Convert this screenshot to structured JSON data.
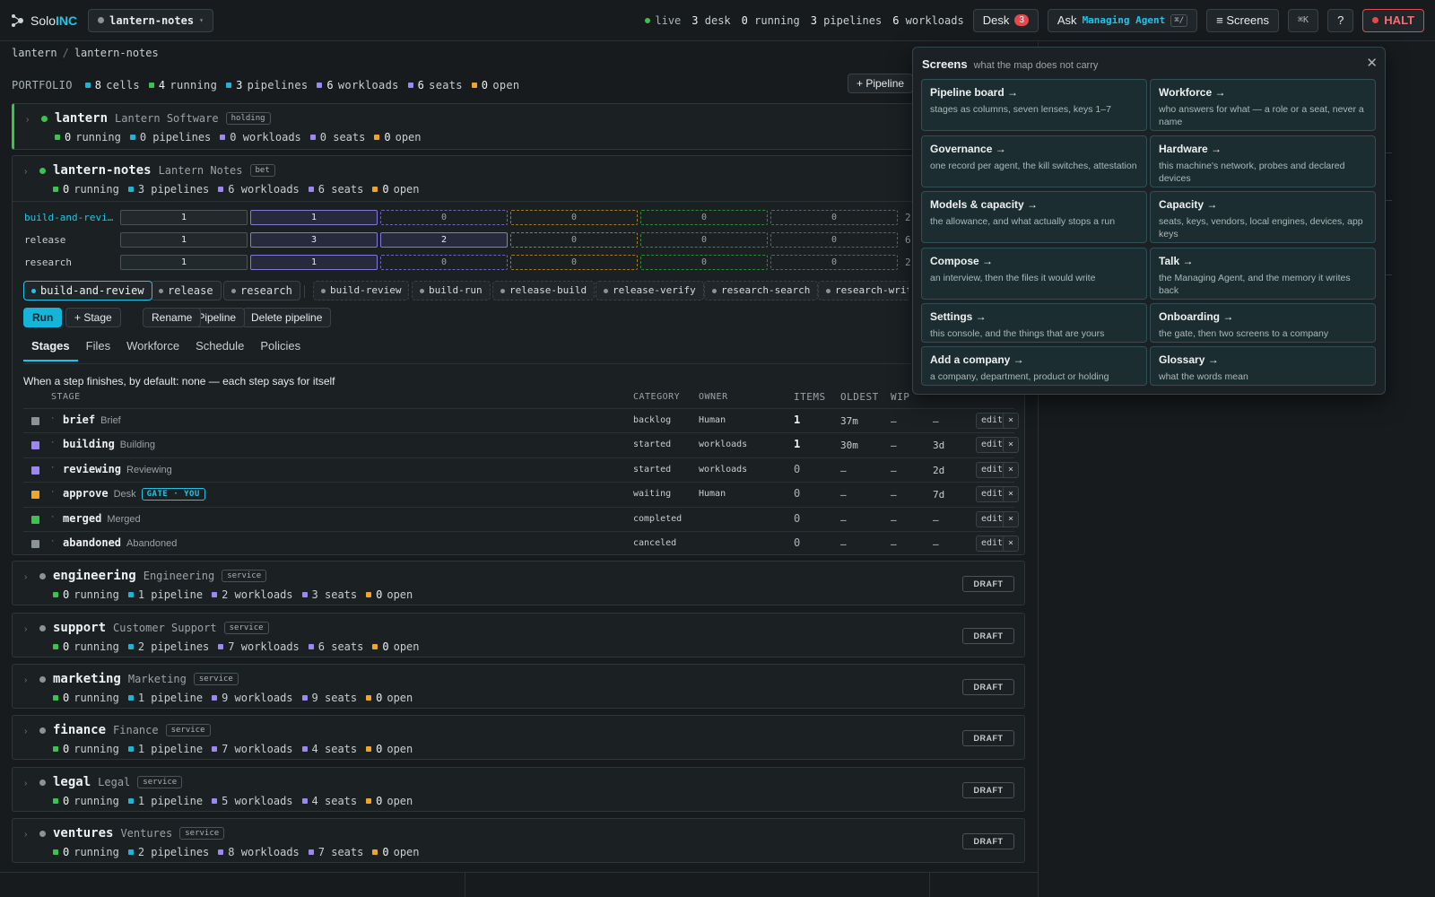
{
  "topbar": {
    "brand_solo": "Solo",
    "brand_inc": "INC",
    "project": "lantern-notes",
    "stats": [
      {
        "value": "live",
        "label": ""
      },
      {
        "value": "3",
        "label": "desk"
      },
      {
        "value": "0",
        "label": "running"
      },
      {
        "value": "3",
        "label": "pipelines"
      },
      {
        "value": "6",
        "label": "workloads"
      }
    ],
    "desk_label": "Desk",
    "desk_count": "3",
    "ask_label": "Ask",
    "ask_agent": "Managing Agent",
    "ask_kbd": "⌘/",
    "screens_label": "≡ Screens",
    "cmdk": "⌘K",
    "help": "?",
    "halt": "HALT"
  },
  "breadcrumb": {
    "root": "lantern",
    "sep": "/",
    "leaf": "lantern-notes"
  },
  "portfolio": {
    "label": "PORTFOLIO",
    "items": [
      {
        "n": "8",
        "l": "cells"
      },
      {
        "n": "4",
        "l": "running"
      },
      {
        "n": "3",
        "l": "pipelines"
      },
      {
        "n": "6",
        "l": "workloads"
      },
      {
        "n": "6",
        "l": "seats"
      },
      {
        "n": "0",
        "l": "open"
      }
    ],
    "add_pipeline": "+ Pipeline"
  },
  "cells": [
    {
      "name": "lantern",
      "full": "Lantern Software",
      "tag": "holding",
      "running": "0",
      "pipelines": "0 pipelines",
      "workloads": "0 workloads",
      "seats": "0 seats",
      "open": "0"
    },
    {
      "name": "lantern-notes",
      "full": "Lantern Notes",
      "tag": "bet",
      "running": "0",
      "pipelines": "3 pipelines",
      "workloads": "6 workloads",
      "seats": "6 seats",
      "open": "0"
    },
    {
      "name": "engineering",
      "full": "Engineering",
      "tag": "service",
      "running": "0",
      "pipelines": "1 pipeline",
      "workloads": "2 workloads",
      "seats": "3 seats",
      "open": "0"
    },
    {
      "name": "support",
      "full": "Customer Support",
      "tag": "service",
      "running": "0",
      "pipelines": "2 pipelines",
      "workloads": "7 workloads",
      "seats": "6 seats",
      "open": "0"
    },
    {
      "name": "marketing",
      "full": "Marketing",
      "tag": "service",
      "running": "0",
      "pipelines": "1 pipeline",
      "workloads": "9 workloads",
      "seats": "9 seats",
      "open": "0"
    },
    {
      "name": "finance",
      "full": "Finance",
      "tag": "service",
      "running": "0",
      "pipelines": "1 pipeline",
      "workloads": "7 workloads",
      "seats": "4 seats",
      "open": "0"
    },
    {
      "name": "legal",
      "full": "Legal",
      "tag": "service",
      "running": "0",
      "pipelines": "1 pipeline",
      "workloads": "5 workloads",
      "seats": "4 seats",
      "open": "0"
    },
    {
      "name": "ventures",
      "full": "Ventures",
      "tag": "service",
      "running": "0",
      "pipelines": "2 pipelines",
      "workloads": "8 workloads",
      "seats": "7 seats",
      "open": "0"
    }
  ],
  "running_suffix": "running",
  "open_suffix": "open",
  "draft": "DRAFT",
  "pipeline_grid": [
    {
      "name": "build-and-revi…",
      "vals": [
        "1",
        "1",
        "0",
        "0",
        "0",
        "0"
      ],
      "tail": "2"
    },
    {
      "name": "release",
      "vals": [
        "1",
        "3",
        "2",
        "0",
        "0",
        "0"
      ],
      "tail": "6"
    },
    {
      "name": "research",
      "vals": [
        "1",
        "1",
        "0",
        "0",
        "0",
        "0"
      ],
      "tail": "2"
    }
  ],
  "pipeline_chips": [
    "build-and-review",
    "release",
    "research"
  ],
  "workload_chips": [
    "build-review",
    "build-run",
    "release-build",
    "release-verify",
    "research-search",
    "research-write"
  ],
  "actions": [
    "Run",
    "+ Stage",
    "Rename",
    "+ Pipeline",
    "Delete pipeline"
  ],
  "tabs": [
    "Stages",
    "Files",
    "Workforce",
    "Schedule",
    "Policies"
  ],
  "default_text": "When a step finishes, by default:  none — each step says for itself",
  "stage_headers": {
    "stage": "STAGE",
    "category": "CATEGORY",
    "owner": "OWNER",
    "items": "ITEMS",
    "oldest": "OLDEST",
    "wip": "WIP"
  },
  "stages": [
    {
      "name": "brief",
      "desc": "Brief",
      "gate": "",
      "category": "backlog",
      "owner": "Human",
      "items": "1",
      "oldest": "37m",
      "wip": "—",
      "extra": "—",
      "color": "#8a9396"
    },
    {
      "name": "building",
      "desc": "Building",
      "gate": "",
      "category": "started",
      "owner": "workloads",
      "items": "1",
      "oldest": "30m",
      "wip": "—",
      "extra": "3d",
      "color": "#9d87f2"
    },
    {
      "name": "reviewing",
      "desc": "Reviewing",
      "gate": "",
      "category": "started",
      "owner": "workloads",
      "items": "0",
      "oldest": "—",
      "wip": "—",
      "extra": "2d",
      "color": "#9d87f2"
    },
    {
      "name": "approve",
      "desc": "Desk",
      "gate": "GATE · YOU",
      "category": "waiting",
      "owner": "Human",
      "items": "0",
      "oldest": "—",
      "wip": "—",
      "extra": "7d",
      "color": "#f0a428"
    },
    {
      "name": "merged",
      "desc": "Merged",
      "gate": "",
      "category": "completed",
      "owner": "",
      "items": "0",
      "oldest": "—",
      "wip": "—",
      "extra": "—",
      "color": "#3bc24f"
    },
    {
      "name": "abandoned",
      "desc": "Abandoned",
      "gate": "",
      "category": "canceled",
      "owner": "",
      "items": "0",
      "oldest": "—",
      "wip": "—",
      "extra": "—",
      "color": "#8a9396"
    }
  ],
  "edit": "edit",
  "remove": "×",
  "screens": {
    "title": "Screens",
    "subtitle": "what the map does not carry",
    "close": "✕",
    "cards": [
      {
        "t": "Pipeline board →",
        "d": "stages as columns, seven lenses, keys 1–7"
      },
      {
        "t": "Workforce →",
        "d": "who answers for what — a role or a seat, never a name"
      },
      {
        "t": "Governance →",
        "d": "one record per agent, the kill switches, attestation"
      },
      {
        "t": "Hardware →",
        "d": "this machine's network, probes and declared devices"
      },
      {
        "t": "Models & capacity →",
        "d": "the allowance, and what actually stops a run"
      },
      {
        "t": "Capacity →",
        "d": "seats, keys, vendors, local engines, devices, app keys"
      },
      {
        "t": "Compose →",
        "d": "an interview, then the files it would write"
      },
      {
        "t": "Talk →",
        "d": "the Managing Agent, and the memory it writes back"
      },
      {
        "t": "Settings →",
        "d": "this console, and the things that are yours"
      },
      {
        "t": "Onboarding →",
        "d": "the gate, then two screens to a company"
      },
      {
        "t": "Add a company →",
        "d": "a company, department, product or holding"
      },
      {
        "t": "Glossary →",
        "d": "what the words mean"
      }
    ]
  }
}
